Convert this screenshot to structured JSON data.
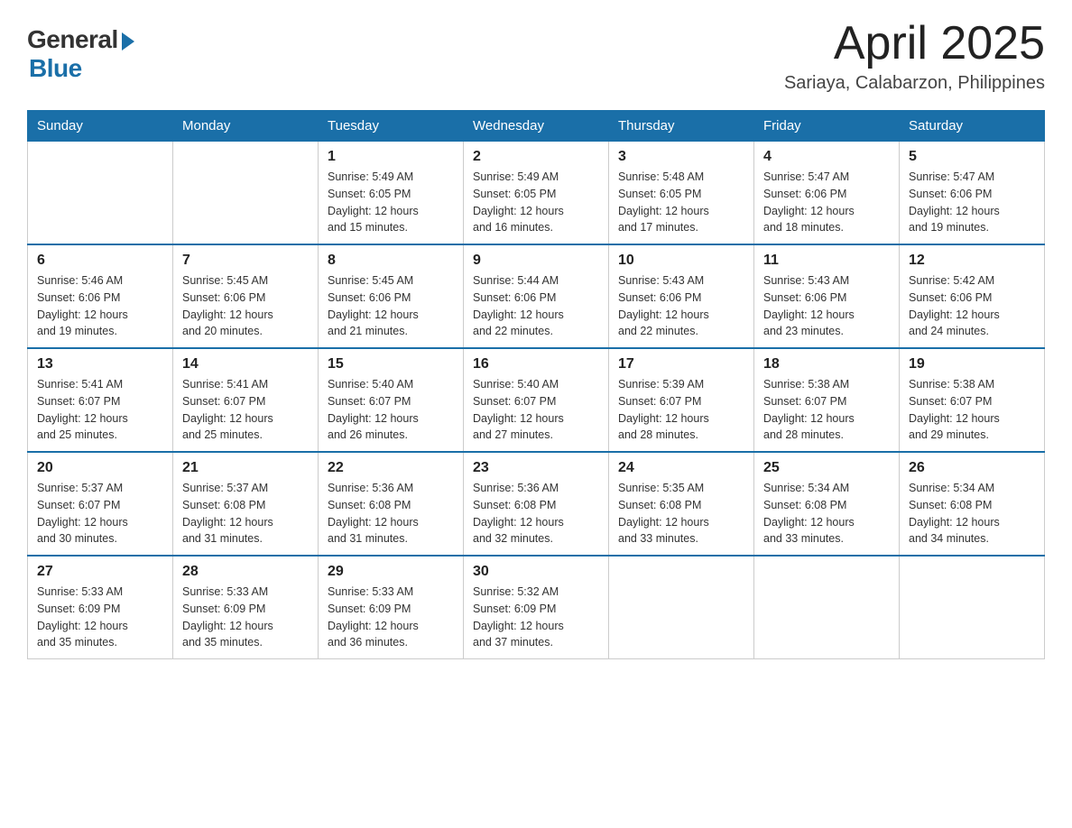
{
  "header": {
    "logo_general": "General",
    "logo_blue": "Blue",
    "title": "April 2025",
    "location": "Sariaya, Calabarzon, Philippines"
  },
  "weekdays": [
    "Sunday",
    "Monday",
    "Tuesday",
    "Wednesday",
    "Thursday",
    "Friday",
    "Saturday"
  ],
  "weeks": [
    [
      {
        "day": "",
        "info": ""
      },
      {
        "day": "",
        "info": ""
      },
      {
        "day": "1",
        "info": "Sunrise: 5:49 AM\nSunset: 6:05 PM\nDaylight: 12 hours\nand 15 minutes."
      },
      {
        "day": "2",
        "info": "Sunrise: 5:49 AM\nSunset: 6:05 PM\nDaylight: 12 hours\nand 16 minutes."
      },
      {
        "day": "3",
        "info": "Sunrise: 5:48 AM\nSunset: 6:05 PM\nDaylight: 12 hours\nand 17 minutes."
      },
      {
        "day": "4",
        "info": "Sunrise: 5:47 AM\nSunset: 6:06 PM\nDaylight: 12 hours\nand 18 minutes."
      },
      {
        "day": "5",
        "info": "Sunrise: 5:47 AM\nSunset: 6:06 PM\nDaylight: 12 hours\nand 19 minutes."
      }
    ],
    [
      {
        "day": "6",
        "info": "Sunrise: 5:46 AM\nSunset: 6:06 PM\nDaylight: 12 hours\nand 19 minutes."
      },
      {
        "day": "7",
        "info": "Sunrise: 5:45 AM\nSunset: 6:06 PM\nDaylight: 12 hours\nand 20 minutes."
      },
      {
        "day": "8",
        "info": "Sunrise: 5:45 AM\nSunset: 6:06 PM\nDaylight: 12 hours\nand 21 minutes."
      },
      {
        "day": "9",
        "info": "Sunrise: 5:44 AM\nSunset: 6:06 PM\nDaylight: 12 hours\nand 22 minutes."
      },
      {
        "day": "10",
        "info": "Sunrise: 5:43 AM\nSunset: 6:06 PM\nDaylight: 12 hours\nand 22 minutes."
      },
      {
        "day": "11",
        "info": "Sunrise: 5:43 AM\nSunset: 6:06 PM\nDaylight: 12 hours\nand 23 minutes."
      },
      {
        "day": "12",
        "info": "Sunrise: 5:42 AM\nSunset: 6:06 PM\nDaylight: 12 hours\nand 24 minutes."
      }
    ],
    [
      {
        "day": "13",
        "info": "Sunrise: 5:41 AM\nSunset: 6:07 PM\nDaylight: 12 hours\nand 25 minutes."
      },
      {
        "day": "14",
        "info": "Sunrise: 5:41 AM\nSunset: 6:07 PM\nDaylight: 12 hours\nand 25 minutes."
      },
      {
        "day": "15",
        "info": "Sunrise: 5:40 AM\nSunset: 6:07 PM\nDaylight: 12 hours\nand 26 minutes."
      },
      {
        "day": "16",
        "info": "Sunrise: 5:40 AM\nSunset: 6:07 PM\nDaylight: 12 hours\nand 27 minutes."
      },
      {
        "day": "17",
        "info": "Sunrise: 5:39 AM\nSunset: 6:07 PM\nDaylight: 12 hours\nand 28 minutes."
      },
      {
        "day": "18",
        "info": "Sunrise: 5:38 AM\nSunset: 6:07 PM\nDaylight: 12 hours\nand 28 minutes."
      },
      {
        "day": "19",
        "info": "Sunrise: 5:38 AM\nSunset: 6:07 PM\nDaylight: 12 hours\nand 29 minutes."
      }
    ],
    [
      {
        "day": "20",
        "info": "Sunrise: 5:37 AM\nSunset: 6:07 PM\nDaylight: 12 hours\nand 30 minutes."
      },
      {
        "day": "21",
        "info": "Sunrise: 5:37 AM\nSunset: 6:08 PM\nDaylight: 12 hours\nand 31 minutes."
      },
      {
        "day": "22",
        "info": "Sunrise: 5:36 AM\nSunset: 6:08 PM\nDaylight: 12 hours\nand 31 minutes."
      },
      {
        "day": "23",
        "info": "Sunrise: 5:36 AM\nSunset: 6:08 PM\nDaylight: 12 hours\nand 32 minutes."
      },
      {
        "day": "24",
        "info": "Sunrise: 5:35 AM\nSunset: 6:08 PM\nDaylight: 12 hours\nand 33 minutes."
      },
      {
        "day": "25",
        "info": "Sunrise: 5:34 AM\nSunset: 6:08 PM\nDaylight: 12 hours\nand 33 minutes."
      },
      {
        "day": "26",
        "info": "Sunrise: 5:34 AM\nSunset: 6:08 PM\nDaylight: 12 hours\nand 34 minutes."
      }
    ],
    [
      {
        "day": "27",
        "info": "Sunrise: 5:33 AM\nSunset: 6:09 PM\nDaylight: 12 hours\nand 35 minutes."
      },
      {
        "day": "28",
        "info": "Sunrise: 5:33 AM\nSunset: 6:09 PM\nDaylight: 12 hours\nand 35 minutes."
      },
      {
        "day": "29",
        "info": "Sunrise: 5:33 AM\nSunset: 6:09 PM\nDaylight: 12 hours\nand 36 minutes."
      },
      {
        "day": "30",
        "info": "Sunrise: 5:32 AM\nSunset: 6:09 PM\nDaylight: 12 hours\nand 37 minutes."
      },
      {
        "day": "",
        "info": ""
      },
      {
        "day": "",
        "info": ""
      },
      {
        "day": "",
        "info": ""
      }
    ]
  ]
}
